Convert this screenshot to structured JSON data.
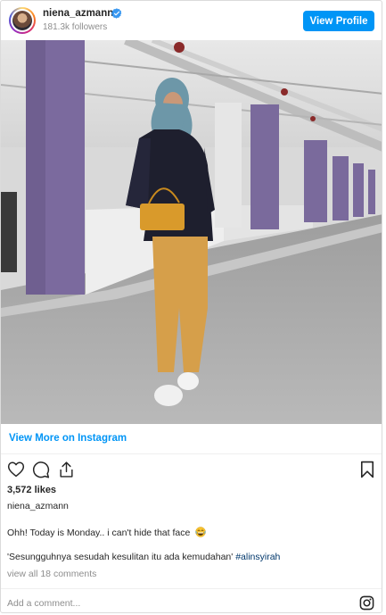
{
  "header": {
    "username": "niena_azmann",
    "followers": "181.3k followers",
    "view_profile_label": "View Profile"
  },
  "post": {
    "view_more_label": "View More on Instagram",
    "likes": "3,572 likes",
    "caption_username": "niena_azmann",
    "caption_line1": "Ohh! Today is Monday.. i can't hide that face",
    "caption_line2": "'Sesungguhnya sesudah kesulitan itu ada kemudahan'",
    "hashtag": "#alinsyirah",
    "view_comments": "view all 18 comments",
    "add_comment_placeholder": "Add a comment..."
  },
  "colors": {
    "accent": "#0095f6",
    "text": "#262626",
    "muted": "#8e8e8e"
  },
  "icons": [
    "verified-badge-icon",
    "heart-icon",
    "comment-icon",
    "share-icon",
    "bookmark-icon",
    "instagram-logo-icon",
    "laughing-emoji-icon"
  ]
}
